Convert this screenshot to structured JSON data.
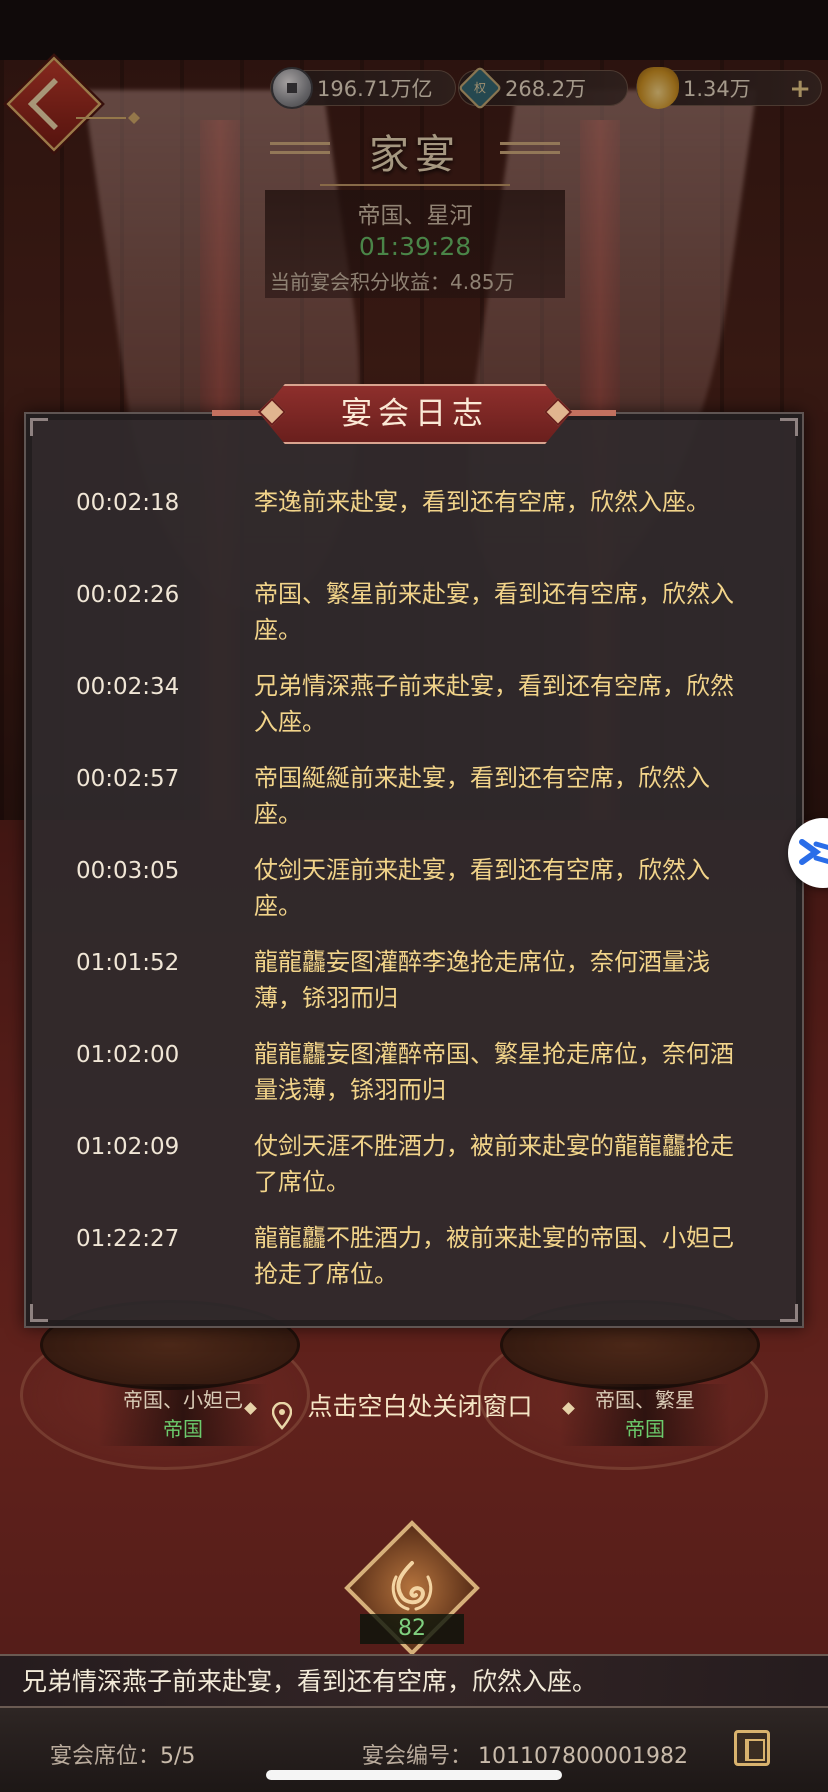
{
  "resources": {
    "silver": {
      "value": "196.71万亿",
      "icon": "silver-coin-icon"
    },
    "token": {
      "value": "268.2万",
      "icon_char": "权",
      "icon": "token-icon"
    },
    "gold": {
      "value": "1.34万",
      "icon": "gold-ingot-icon"
    }
  },
  "header": {
    "title": "家宴",
    "host": "帝国、星河",
    "timer": "01:39:28",
    "score_label": "当前宴会积分收益：",
    "score_value": "4.85万"
  },
  "dialog": {
    "title": "宴会日志",
    "entries": [
      {
        "time": "00:02:18",
        "text": "李逸前来赴宴，看到还有空席，欣然入座。"
      },
      {
        "time": "00:02:26",
        "text": "帝国、繁星前来赴宴，看到还有空席，欣然入座。"
      },
      {
        "time": "00:02:34",
        "text": "兄弟情深燕子前来赴宴，看到还有空席，欣然入座。"
      },
      {
        "time": "00:02:57",
        "text": "帝国綖綖前来赴宴，看到还有空席，欣然入座。"
      },
      {
        "time": "00:03:05",
        "text": "仗剑天涯前来赴宴，看到还有空席，欣然入座。"
      },
      {
        "time": "01:01:52",
        "text": "龍龍龘妄图灌醉李逸抢走席位，奈何酒量浅薄，铩羽而归"
      },
      {
        "time": "01:02:00",
        "text": "龍龍龘妄图灌醉帝国、繁星抢走席位，奈何酒量浅薄，铩羽而归"
      },
      {
        "time": "01:02:09",
        "text": "仗剑天涯不胜酒力，被前来赴宴的龍龍龘抢走了席位。"
      },
      {
        "time": "01:22:27",
        "text": "龍龍龘不胜酒力，被前来赴宴的帝国、小妲己抢走了席位。"
      }
    ]
  },
  "seats": {
    "left": {
      "name": "帝国、小妲己",
      "group": "帝国"
    },
    "right": {
      "name": "帝国、繁星",
      "group": "帝国"
    }
  },
  "close_hint": "点击空白处关闭窗口",
  "emblem_count": "82",
  "ticker": "兄弟情深燕子前来赴宴，看到还有空席，欣然入座。",
  "footer": {
    "seats_label": "宴会席位：",
    "seats_value": "5/5",
    "code_label": "宴会编号：",
    "code_value": "101107800001982"
  },
  "colors": {
    "timer": "#68c86a",
    "log_text": "#f2d48a",
    "dialog_title_bg": "#8e2f2c"
  }
}
